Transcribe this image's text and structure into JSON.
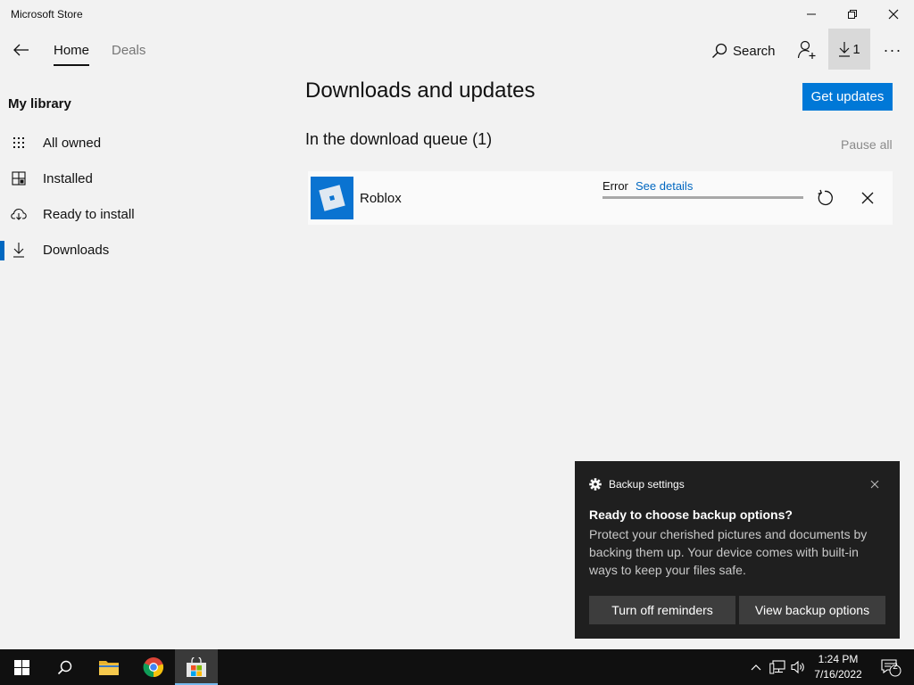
{
  "window": {
    "title": "Microsoft Store"
  },
  "nav": {
    "tabs": [
      {
        "label": "Home"
      },
      {
        "label": "Deals"
      }
    ],
    "search_label": "Search",
    "downloads_count": "1",
    "more_label": "···"
  },
  "sidebar": {
    "title": "My library",
    "items": [
      {
        "label": "All owned",
        "icon": "grid-icon"
      },
      {
        "label": "Installed",
        "icon": "installed-icon"
      },
      {
        "label": "Ready to install",
        "icon": "cloud-download-icon"
      },
      {
        "label": "Downloads",
        "icon": "download-icon",
        "selected": true
      }
    ]
  },
  "main": {
    "title": "Downloads and updates",
    "get_updates_label": "Get updates",
    "queue_title": "In the download queue (1)",
    "pause_all_label": "Pause all",
    "downloads": [
      {
        "app_name": "Roblox",
        "status": "Error",
        "details_link": "See details",
        "progress": 1.0
      }
    ]
  },
  "toast": {
    "app": "Backup settings",
    "title": "Ready to choose backup options?",
    "body": "Protect your cherished pictures and documents by backing them up. Your device comes with built-in ways to keep your files safe.",
    "buttons": [
      "Turn off reminders",
      "View backup options"
    ]
  },
  "taskbar": {
    "time": "1:24 PM",
    "date": "7/16/2022",
    "notifications": "2"
  },
  "colors": {
    "accent": "#0078d7",
    "link": "#0067c0",
    "toast_bg": "#1f1f1f",
    "taskbar_bg": "#101010"
  }
}
